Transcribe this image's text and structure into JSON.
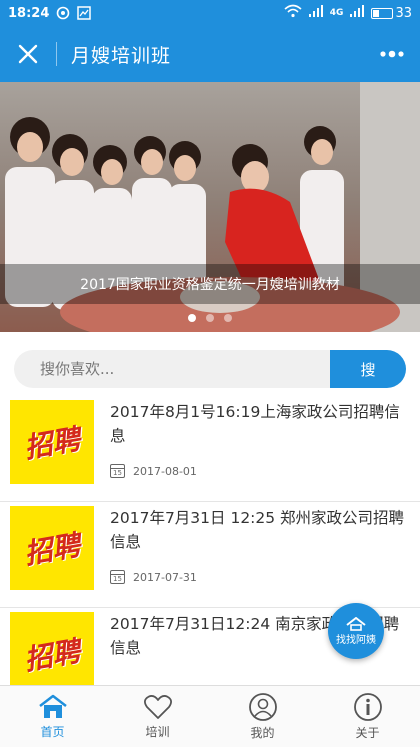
{
  "status_bar": {
    "time": "18:24",
    "network": "4G",
    "battery": "33",
    "battery_level": 0.33
  },
  "header": {
    "title": "月嫂培训班",
    "close_icon": "close-icon",
    "more_icon": "more-dots-icon"
  },
  "banner": {
    "caption": "2017国家职业资格鉴定统一月嫂培训教材",
    "slide_count": 3,
    "active_slide": 0
  },
  "search": {
    "placeholder": "搜你喜欢...",
    "button_label": "搜"
  },
  "news": [
    {
      "title": "2017年8月1号16:19上海家政公司招聘信息",
      "date": "2017-08-01",
      "thumb_text": "招聘",
      "cal_day": "15"
    },
    {
      "title": "2017年7月31日 12:25 郑州家政公司招聘信息",
      "date": "2017-07-31",
      "thumb_text": "招聘",
      "cal_day": "15"
    },
    {
      "title": "2017年7月31日12:24 南京家政公司招聘信息",
      "date": "",
      "thumb_text": "招聘",
      "cal_day": "15"
    }
  ],
  "floating_button": {
    "label": "找找阿姨"
  },
  "tabs": [
    {
      "label": "首页",
      "icon": "home-icon",
      "active": true
    },
    {
      "label": "培训",
      "icon": "heart-icon",
      "active": false
    },
    {
      "label": "我的",
      "icon": "user-icon",
      "active": false
    },
    {
      "label": "关于",
      "icon": "info-icon",
      "active": false
    }
  ],
  "colors": {
    "primary": "#1f8fdc",
    "thumb_bg": "#ffe600",
    "thumb_text": "#d42a1c"
  }
}
